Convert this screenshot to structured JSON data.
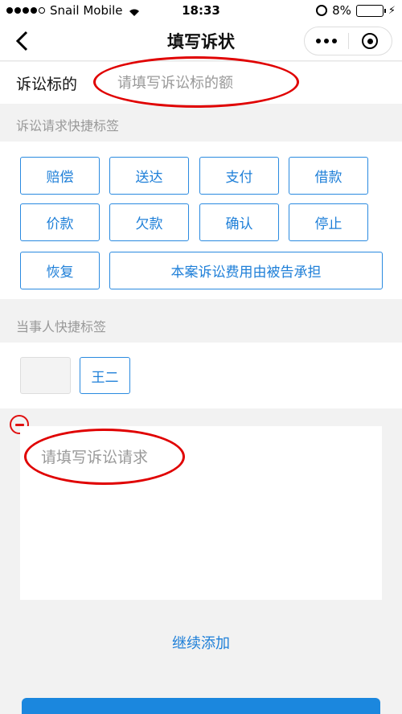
{
  "status_bar": {
    "carrier": "Snail Mobile",
    "time": "18:33",
    "battery_percent": "8%",
    "battery_level": 0.08
  },
  "nav": {
    "title": "填写诉状"
  },
  "subject": {
    "label": "诉讼标的",
    "placeholder": "请填写诉讼标的额"
  },
  "request_tags": {
    "header": "诉讼请求快捷标签",
    "items": [
      "赔偿",
      "送达",
      "支付",
      "借款",
      "价款",
      "欠款",
      "确认",
      "停止",
      "恢复",
      "本案诉讼费用由被告承担"
    ]
  },
  "party_tags": {
    "header": "当事人快捷标签",
    "items": [
      "",
      "王二"
    ]
  },
  "request_input": {
    "placeholder": "请填写诉讼请求"
  },
  "actions": {
    "add_more": "继续添加"
  },
  "colors": {
    "accent": "#1e7fd8",
    "annotation_red": "#e00000"
  }
}
